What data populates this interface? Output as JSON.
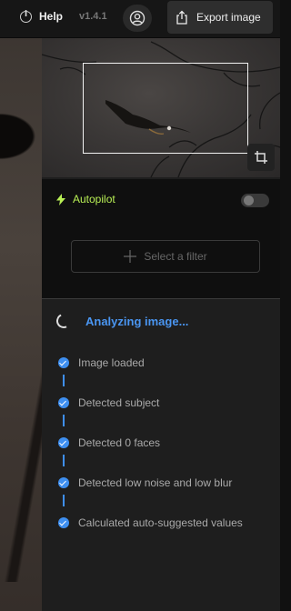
{
  "topbar": {
    "help_label": "Help",
    "version": "v1.4.1",
    "export_label": "Export image"
  },
  "autopilot": {
    "label": "Autopilot",
    "enabled": false,
    "filter_placeholder": "Select a filter"
  },
  "analysis": {
    "status": "Analyzing image...",
    "steps": [
      {
        "label": "Image loaded",
        "done": true
      },
      {
        "label": "Detected subject",
        "done": true
      },
      {
        "label": "Detected 0 faces",
        "done": true
      },
      {
        "label": "Detected low noise and low blur",
        "done": true
      },
      {
        "label": "Calculated auto-suggested values",
        "done": true
      }
    ]
  },
  "colors": {
    "accent_blue": "#4a96f2",
    "autopilot_green": "#b8ef55"
  }
}
